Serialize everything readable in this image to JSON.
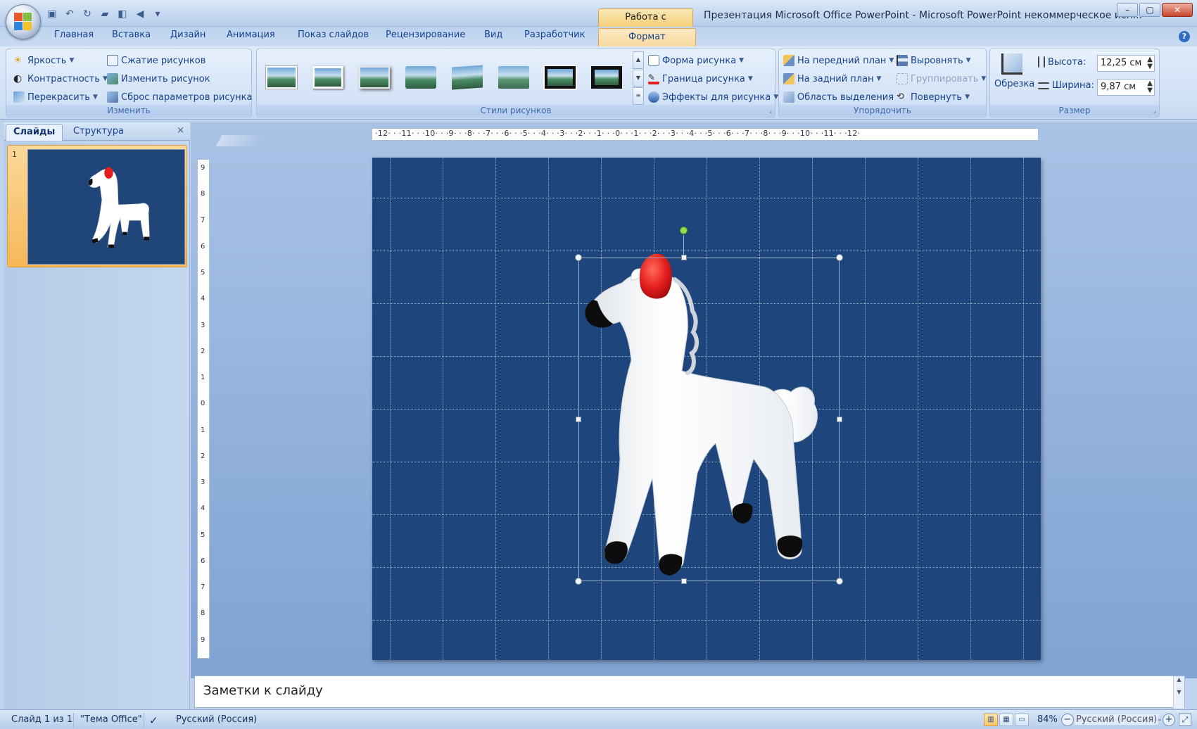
{
  "window": {
    "contextual_tab_group": "Работа с рисунками",
    "title": "Презентация Microsoft Office PowerPoint - Microsoft PowerPoint некоммерческое исп...",
    "controls": {
      "minimize": "–",
      "maximize": "▢",
      "close": "✕"
    }
  },
  "quick_access": [
    "save-icon",
    "undo-icon",
    "redo-icon",
    "open-icon",
    "print-preview-icon",
    "sound-icon",
    "customize-icon"
  ],
  "ribbon_tabs": [
    "Главная",
    "Вставка",
    "Дизайн",
    "Анимация",
    "Показ слайдов",
    "Рецензирование",
    "Вид",
    "Разработчик",
    "Формат"
  ],
  "active_tab": "Формат",
  "groups": {
    "adjust": {
      "label": "Изменить",
      "brightness": "Яркость",
      "contrast": "Контрастность",
      "recolor": "Перекрасить",
      "compress": "Сжатие рисунков",
      "change_picture": "Изменить рисунок",
      "reset_picture": "Сброс параметров рисунка"
    },
    "picture_styles": {
      "label": "Стили рисунков",
      "shape": "Форма рисунка",
      "border": "Граница рисунка",
      "effects": "Эффекты для рисунка"
    },
    "arrange": {
      "label": "Упорядочить",
      "bring_front": "На передний план",
      "send_back": "На задний план",
      "selection_pane": "Область выделения",
      "align": "Выровнять",
      "group": "Группировать",
      "rotate": "Повернуть"
    },
    "size": {
      "label": "Размер",
      "crop": "Обрезка",
      "height_label": "Высота:",
      "height_value": "12,25 см",
      "width_label": "Ширина:",
      "width_value": "9,87 см"
    }
  },
  "left_panel": {
    "tab_slides": "Слайды",
    "tab_outline": "Структура",
    "close": "×",
    "slide_number": "1"
  },
  "ruler": {
    "horizontal": "·12· · ·11· · ·10· · ·9· · ·8· · ·7· · ·6· · ·5· · ·4· · ·3· · ·2· · ·1· · ·0· · ·1· · ·2· · ·3· · ·4· · ·5· · ·6· · ·7· · ·8· · ·9· · ·10· · ·11· · ·12·",
    "vertical": [
      "9",
      "8",
      "7",
      "6",
      "5",
      "4",
      "3",
      "2",
      "1",
      "0",
      "1",
      "2",
      "3",
      "4",
      "5",
      "6",
      "7",
      "8",
      "9"
    ]
  },
  "notes": {
    "placeholder": "Заметки к слайду"
  },
  "status": {
    "slide": "Слайд 1 из 1",
    "theme": "\"Тема Office\"",
    "language": "Русский (Россия)",
    "zoom": "84%",
    "zoom_overlay_language": "Русский (Россия)"
  },
  "colors": {
    "slide_background": "#1f467c",
    "accent_active_tab": "#f7d89a",
    "horse_body": "#ffffff",
    "horse_mane": "#e41e1e",
    "horse_hooves": "#0a0a0a"
  }
}
